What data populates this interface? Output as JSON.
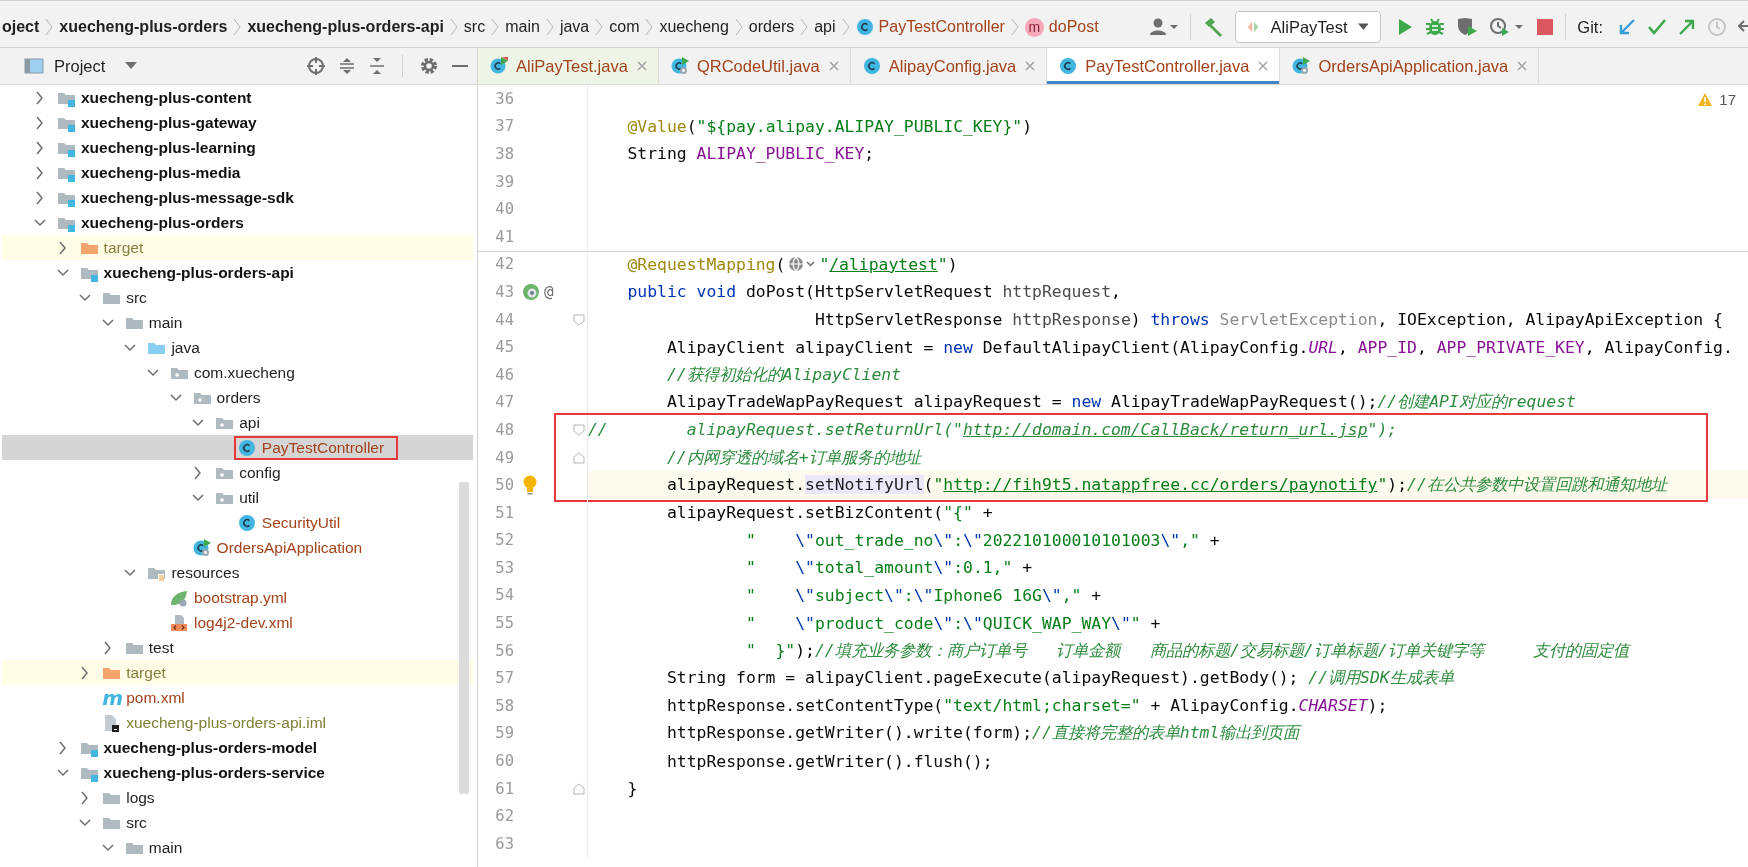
{
  "breadcrumbs": [
    {
      "label": "oject",
      "kind": "plain",
      "bold": true
    },
    {
      "label": "xuecheng-plus-orders",
      "kind": "plain",
      "bold": true
    },
    {
      "label": "xuecheng-plus-orders-api",
      "kind": "plain",
      "bold": true
    },
    {
      "label": "src",
      "kind": "plain",
      "bold": false
    },
    {
      "label": "main",
      "kind": "plain",
      "bold": false
    },
    {
      "label": "java",
      "kind": "plain",
      "bold": false
    },
    {
      "label": "com",
      "kind": "plain",
      "bold": false
    },
    {
      "label": "xuecheng",
      "kind": "plain",
      "bold": false
    },
    {
      "label": "orders",
      "kind": "plain",
      "bold": false
    },
    {
      "label": "api",
      "kind": "plain",
      "bold": false
    },
    {
      "label": "PayTestController",
      "kind": "class",
      "bold": false
    },
    {
      "label": "doPost",
      "kind": "method",
      "bold": false,
      "icon_text": "m"
    }
  ],
  "toolbar": {
    "run_config": "AliPayTest",
    "git_label": "Git:"
  },
  "project_panel": {
    "title": "Project",
    "tree": [
      {
        "name": "xuecheng-plus-content",
        "kind": "module",
        "expanded": false,
        "selected": false,
        "outlined": false
      },
      {
        "name": "xuecheng-plus-gateway",
        "kind": "module",
        "expanded": false,
        "selected": false,
        "outlined": false
      },
      {
        "name": "xuecheng-plus-learning",
        "kind": "module",
        "expanded": false,
        "selected": false,
        "outlined": false
      },
      {
        "name": "xuecheng-plus-media",
        "kind": "module",
        "expanded": false,
        "selected": false,
        "outlined": false
      },
      {
        "name": "xuecheng-plus-message-sdk",
        "kind": "module",
        "expanded": false,
        "selected": false,
        "outlined": false
      },
      {
        "name": "xuecheng-plus-orders",
        "kind": "module",
        "expanded": true,
        "selected": false,
        "outlined": false,
        "children": [
          {
            "name": "target",
            "kind": "excluded",
            "expanded": false,
            "selected": false,
            "outlined": false
          },
          {
            "name": "xuecheng-plus-orders-api",
            "kind": "module",
            "expanded": true,
            "selected": false,
            "outlined": false,
            "children": [
              {
                "name": "src",
                "kind": "folder",
                "expanded": true,
                "selected": false,
                "outlined": false,
                "children": [
                  {
                    "name": "main",
                    "kind": "folder",
                    "expanded": true,
                    "selected": false,
                    "outlined": false,
                    "children": [
                      {
                        "name": "java",
                        "kind": "source",
                        "expanded": true,
                        "selected": false,
                        "outlined": false,
                        "children": [
                          {
                            "name": "com.xuecheng",
                            "kind": "package",
                            "expanded": true,
                            "selected": false,
                            "outlined": false,
                            "children": [
                              {
                                "name": "orders",
                                "kind": "package",
                                "expanded": true,
                                "selected": false,
                                "outlined": false,
                                "children": [
                                  {
                                    "name": "api",
                                    "kind": "package",
                                    "expanded": true,
                                    "selected": false,
                                    "outlined": false,
                                    "children": [
                                      {
                                        "name": "PayTestController",
                                        "kind": "class",
                                        "selected": true,
                                        "outlined": true
                                      }
                                    ]
                                  },
                                  {
                                    "name": "config",
                                    "kind": "package",
                                    "expanded": false,
                                    "selected": false,
                                    "outlined": false
                                  },
                                  {
                                    "name": "util",
                                    "kind": "package",
                                    "expanded": true,
                                    "selected": false,
                                    "outlined": false,
                                    "children": [
                                      {
                                        "name": "SecurityUtil",
                                        "kind": "class",
                                        "selected": false,
                                        "outlined": false
                                      }
                                    ]
                                  }
                                ]
                              },
                              {
                                "name": "OrdersApiApplication",
                                "kind": "app",
                                "selected": false,
                                "outlined": false
                              }
                            ]
                          }
                        ]
                      },
                      {
                        "name": "resources",
                        "kind": "resources",
                        "expanded": true,
                        "selected": false,
                        "outlined": false,
                        "children": [
                          {
                            "name": "bootstrap.yml",
                            "kind": "yml",
                            "selected": false,
                            "outlined": false
                          },
                          {
                            "name": "log4j2-dev.xml",
                            "kind": "xml",
                            "selected": false,
                            "outlined": false
                          }
                        ]
                      }
                    ]
                  },
                  {
                    "name": "test",
                    "kind": "folder",
                    "expanded": false,
                    "selected": false,
                    "outlined": false
                  }
                ]
              },
              {
                "name": "target",
                "kind": "excluded",
                "expanded": false,
                "selected": false,
                "outlined": false
              },
              {
                "name": "pom.xml",
                "kind": "maven",
                "icon_text": "m",
                "selected": false,
                "outlined": false
              },
              {
                "name": "xuecheng-plus-orders-api.iml",
                "kind": "iml",
                "selected": false,
                "outlined": false
              }
            ]
          },
          {
            "name": "xuecheng-plus-orders-model",
            "kind": "module",
            "expanded": false,
            "selected": false,
            "outlined": false
          },
          {
            "name": "xuecheng-plus-orders-service",
            "kind": "module",
            "expanded": true,
            "selected": false,
            "outlined": false,
            "children": [
              {
                "name": "logs",
                "kind": "folder",
                "expanded": false,
                "selected": false,
                "outlined": false
              },
              {
                "name": "src",
                "kind": "folder",
                "expanded": true,
                "selected": false,
                "outlined": false,
                "children": [
                  {
                    "name": "main",
                    "kind": "folder",
                    "expanded": true,
                    "selected": false,
                    "outlined": false
                  }
                ]
              }
            ]
          }
        ]
      }
    ]
  },
  "tabs": [
    {
      "label": "AliPayTest.java",
      "kind": "test",
      "selected": false
    },
    {
      "label": "QRCodeUtil.java",
      "kind": "app",
      "selected": false
    },
    {
      "label": "AlipayConfig.java",
      "kind": "class",
      "selected": false
    },
    {
      "label": "PayTestController.java",
      "kind": "class",
      "selected": true
    },
    {
      "label": "OrdersApiApplication.java",
      "kind": "app",
      "selected": false
    }
  ],
  "editor": {
    "warnings": "17",
    "lines": [
      {
        "number": "36",
        "outlined": false,
        "current": false,
        "separator": false
      },
      {
        "number": "37",
        "outlined": false,
        "current": false,
        "separator": false,
        "tokens": [
          {
            "kind": "ann",
            "text": "    @Value"
          },
          {
            "kind": "plain",
            "text": "("
          },
          {
            "kind": "str",
            "text": "\"${pay.alipay.ALIPAY_PUBLIC_KEY}\""
          },
          {
            "kind": "plain",
            "text": ")"
          }
        ]
      },
      {
        "number": "38",
        "outlined": false,
        "current": false,
        "separator": false,
        "tokens": [
          {
            "kind": "plain",
            "text": "    String "
          },
          {
            "kind": "field",
            "text": "ALIPAY_PUBLIC_KEY"
          },
          {
            "kind": "plain",
            "text": ";"
          }
        ]
      },
      {
        "number": "39",
        "outlined": false,
        "current": false,
        "separator": false
      },
      {
        "number": "40",
        "outlined": false,
        "current": false,
        "separator": false
      },
      {
        "number": "41",
        "outlined": false,
        "current": false,
        "separator": false
      },
      {
        "number": "42",
        "outlined": false,
        "current": false,
        "separator": true,
        "tokens": [
          {
            "kind": "ann",
            "text": "    @RequestMapping"
          },
          {
            "kind": "plain",
            "text": "("
          },
          {
            "kind": "globe"
          },
          {
            "kind": "str",
            "text": "\""
          },
          {
            "kind": "url",
            "text": "/alipaytest"
          },
          {
            "kind": "str",
            "text": "\""
          },
          {
            "kind": "plain",
            "text": ")"
          }
        ]
      },
      {
        "number": "43",
        "outlined": false,
        "current": false,
        "separator": false,
        "gutter": [
          {
            "kind": "bean"
          },
          {
            "kind": "mark",
            "text": "@"
          }
        ],
        "tokens": [
          {
            "kind": "kw",
            "text": "    public void"
          },
          {
            "kind": "plain",
            "text": " doPost(HttpServletRequest "
          },
          {
            "kind": "param",
            "text": "httpRequest"
          },
          {
            "kind": "plain",
            "text": ","
          }
        ]
      },
      {
        "number": "44",
        "outlined": false,
        "current": false,
        "separator": false,
        "fold_marker": {
          "kind": "start"
        },
        "tokens": [
          {
            "kind": "plain",
            "text": "                       HttpServletResponse "
          },
          {
            "kind": "param",
            "text": "httpResponse"
          },
          {
            "kind": "plain",
            "text": ") "
          },
          {
            "kind": "kw",
            "text": "throws "
          },
          {
            "kind": "unused",
            "text": "ServletException"
          },
          {
            "kind": "plain",
            "text": ", IOException, AlipayApiException {"
          }
        ]
      },
      {
        "number": "45",
        "outlined": false,
        "current": false,
        "separator": false,
        "tokens": [
          {
            "kind": "plain",
            "text": "        AlipayClient alipayClient = "
          },
          {
            "kind": "kw",
            "text": "new"
          },
          {
            "kind": "plain",
            "text": " DefaultAlipayClient(AlipayConfig."
          },
          {
            "kind": "static",
            "text": "URL"
          },
          {
            "kind": "plain",
            "text": ", "
          },
          {
            "kind": "field",
            "text": "APP_ID"
          },
          {
            "kind": "plain",
            "text": ", "
          },
          {
            "kind": "field",
            "text": "APP_PRIVATE_KEY"
          },
          {
            "kind": "plain",
            "text": ", AlipayConfig."
          }
        ]
      },
      {
        "number": "46",
        "outlined": false,
        "current": false,
        "separator": false,
        "tokens": [
          {
            "kind": "comment",
            "text": "        //获得初始化的AlipayClient"
          }
        ]
      },
      {
        "number": "47",
        "outlined": false,
        "current": false,
        "separator": false,
        "tokens": [
          {
            "kind": "plain",
            "text": "        AlipayTradeWapPayRequest alipayRequest = "
          },
          {
            "kind": "kw",
            "text": "new"
          },
          {
            "kind": "plain",
            "text": " AlipayTradeWapPayRequest();"
          },
          {
            "kind": "comment",
            "text": "//创建API对应的request"
          }
        ]
      },
      {
        "number": "48",
        "outlined": true,
        "current": false,
        "separator": false,
        "fold_marker": {
          "kind": "start"
        },
        "tokens": [
          {
            "kind": "comment",
            "text": "//        alipayRequest.setReturnUrl(\""
          },
          {
            "kind": "curl",
            "text": "http://domain.com/CallBack/return_url.jsp"
          },
          {
            "kind": "comment",
            "text": "\");"
          }
        ]
      },
      {
        "number": "49",
        "outlined": true,
        "current": false,
        "separator": false,
        "fold_marker": {
          "kind": "end"
        },
        "tokens": [
          {
            "kind": "comment",
            "text": "        //内网穿透的域名+订单服务的地址"
          }
        ]
      },
      {
        "number": "50",
        "outlined": true,
        "current": true,
        "separator": false,
        "gutter": [
          {
            "kind": "bulb"
          }
        ],
        "tokens": [
          {
            "kind": "plain",
            "text": "        alipayRequest."
          },
          {
            "kind": "hl",
            "text": "setNotifyUrl"
          },
          {
            "kind": "plain",
            "text": "("
          },
          {
            "kind": "str",
            "text": "\""
          },
          {
            "kind": "url",
            "text": "http://fih9t5.natappfree.cc/orders/paynotify"
          },
          {
            "kind": "str",
            "text": "\""
          },
          {
            "kind": "plain",
            "text": ");"
          },
          {
            "kind": "comment",
            "text": "//在公共参数中设置回跳和通知地址"
          }
        ]
      },
      {
        "number": "51",
        "outlined": false,
        "current": false,
        "separator": false,
        "tokens": [
          {
            "kind": "plain",
            "text": "        alipayRequest.setBizContent("
          },
          {
            "kind": "str",
            "text": "\"{\""
          },
          {
            "kind": "plain",
            "text": " +"
          }
        ]
      },
      {
        "number": "52",
        "outlined": false,
        "current": false,
        "separator": false,
        "tokens": [
          {
            "kind": "str",
            "text": "                \"    "
          },
          {
            "kind": "esc",
            "text": "\\\""
          },
          {
            "kind": "str",
            "text": "out_trade_no"
          },
          {
            "kind": "esc",
            "text": "\\\""
          },
          {
            "kind": "str",
            "text": ":"
          },
          {
            "kind": "esc",
            "text": "\\\""
          },
          {
            "kind": "str",
            "text": "202210100010101003"
          },
          {
            "kind": "esc",
            "text": "\\\""
          },
          {
            "kind": "str",
            "text": ",\""
          },
          {
            "kind": "plain",
            "text": " +"
          }
        ]
      },
      {
        "number": "53",
        "outlined": false,
        "current": false,
        "separator": false,
        "tokens": [
          {
            "kind": "str",
            "text": "                \"    "
          },
          {
            "kind": "esc",
            "text": "\\\""
          },
          {
            "kind": "str",
            "text": "total_amount"
          },
          {
            "kind": "esc",
            "text": "\\\""
          },
          {
            "kind": "str",
            "text": ":0.1,\""
          },
          {
            "kind": "plain",
            "text": " +"
          }
        ]
      },
      {
        "number": "54",
        "outlined": false,
        "current": false,
        "separator": false,
        "tokens": [
          {
            "kind": "str",
            "text": "                \"    "
          },
          {
            "kind": "esc",
            "text": "\\\""
          },
          {
            "kind": "str",
            "text": "subject"
          },
          {
            "kind": "esc",
            "text": "\\\""
          },
          {
            "kind": "str",
            "text": ":"
          },
          {
            "kind": "esc",
            "text": "\\\""
          },
          {
            "kind": "str",
            "text": "Iphone6 16G"
          },
          {
            "kind": "esc",
            "text": "\\\""
          },
          {
            "kind": "str",
            "text": ",\""
          },
          {
            "kind": "plain",
            "text": " +"
          }
        ]
      },
      {
        "number": "55",
        "outlined": false,
        "current": false,
        "separator": false,
        "tokens": [
          {
            "kind": "str",
            "text": "                \"    "
          },
          {
            "kind": "esc",
            "text": "\\\""
          },
          {
            "kind": "str",
            "text": "product_code"
          },
          {
            "kind": "esc",
            "text": "\\\""
          },
          {
            "kind": "str",
            "text": ":"
          },
          {
            "kind": "esc",
            "text": "\\\""
          },
          {
            "kind": "str",
            "text": "QUICK_WAP_WAY"
          },
          {
            "kind": "esc",
            "text": "\\\""
          },
          {
            "kind": "str",
            "text": "\""
          },
          {
            "kind": "plain",
            "text": " +"
          }
        ]
      },
      {
        "number": "56",
        "outlined": false,
        "current": false,
        "separator": false,
        "tokens": [
          {
            "kind": "str",
            "text": "                \"  }\""
          },
          {
            "kind": "plain",
            "text": ");"
          },
          {
            "kind": "comment",
            "text": "//填充业务参数：商户订单号   订单金额   商品的标题/交易标题/订单标题/订单关键字等     支付的固定值"
          }
        ]
      },
      {
        "number": "57",
        "outlined": false,
        "current": false,
        "separator": false,
        "tokens": [
          {
            "kind": "plain",
            "text": "        String form = alipayClient.pageExecute(alipayRequest).getBody(); "
          },
          {
            "kind": "comment",
            "text": "//调用SDK生成表单"
          }
        ]
      },
      {
        "number": "58",
        "outlined": false,
        "current": false,
        "separator": false,
        "tokens": [
          {
            "kind": "plain",
            "text": "        httpResponse.setContentType("
          },
          {
            "kind": "str",
            "text": "\"text/html;charset=\""
          },
          {
            "kind": "plain",
            "text": " + AlipayConfig."
          },
          {
            "kind": "static",
            "text": "CHARSET"
          },
          {
            "kind": "plain",
            "text": ");"
          }
        ]
      },
      {
        "number": "59",
        "outlined": false,
        "current": false,
        "separator": false,
        "tokens": [
          {
            "kind": "plain",
            "text": "        httpResponse.getWriter().write(form);"
          },
          {
            "kind": "comment",
            "text": "//直接将完整的表单html输出到页面"
          }
        ]
      },
      {
        "number": "60",
        "outlined": false,
        "current": false,
        "separator": false,
        "tokens": [
          {
            "kind": "plain",
            "text": "        httpResponse.getWriter().flush();"
          }
        ]
      },
      {
        "number": "61",
        "outlined": false,
        "current": false,
        "separator": false,
        "fold_marker": {
          "kind": "end"
        },
        "tokens": [
          {
            "kind": "plain",
            "text": "    }"
          }
        ]
      },
      {
        "number": "62",
        "outlined": false,
        "current": false,
        "separator": false
      },
      {
        "number": "63",
        "outlined": false,
        "current": false,
        "separator": false
      }
    ]
  }
}
